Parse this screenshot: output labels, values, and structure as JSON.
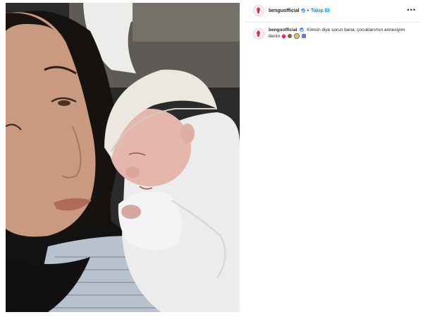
{
  "post": {
    "username": "benguofficial",
    "follow_label": "Takip Et",
    "dot": "•",
    "more_label": "•••",
    "caption_text": "Kimsin diye sorun bana; çocuklarımın annesiyim derim",
    "emojis": [
      "heart",
      "woman-face",
      "baby-face",
      "person-face"
    ]
  },
  "colors": {
    "follow": "#0095f6",
    "verified": "#3897f0",
    "heart": "#e0245e"
  }
}
